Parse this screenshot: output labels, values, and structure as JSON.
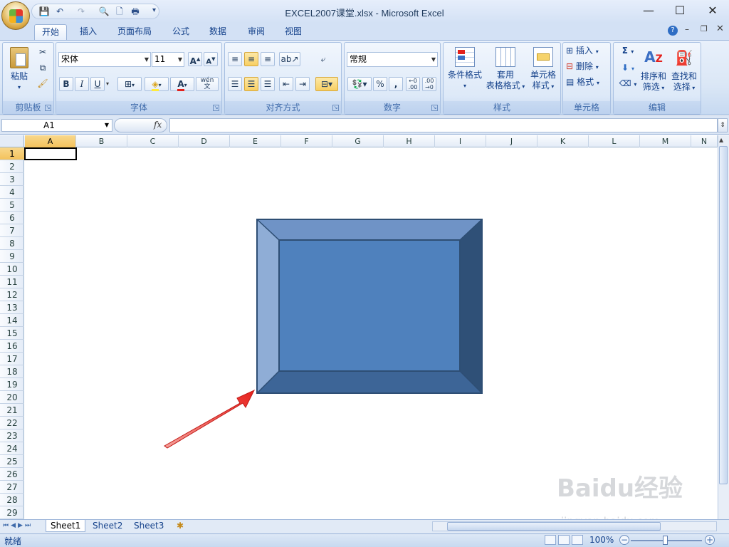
{
  "window": {
    "title": "EXCEL2007课堂.xlsx - Microsoft Excel",
    "minimize": "—",
    "maximize": "☐",
    "close": "✕"
  },
  "qat": {
    "items": [
      "save-icon",
      "undo-icon",
      "redo-icon",
      "print-preview-icon",
      "new-icon",
      "print-icon"
    ],
    "more": "▾"
  },
  "tabs": [
    "开始",
    "插入",
    "页面布局",
    "公式",
    "数据",
    "审阅",
    "视图"
  ],
  "active_tab": "开始",
  "ribbon": {
    "clipboard": {
      "label": "剪贴板",
      "paste": "粘贴"
    },
    "font": {
      "label": "字体",
      "font_name": "宋体",
      "font_size": "11",
      "bold": "B",
      "italic": "I",
      "underline": "U",
      "grow": "A",
      "shrink": "A",
      "phonetic": "wén"
    },
    "alignment": {
      "label": "对齐方式"
    },
    "number": {
      "label": "数字",
      "format": "常规",
      "percent": "%",
      "comma": ","
    },
    "styles": {
      "label": "样式",
      "conditional": "条件格式",
      "table_format_1": "套用",
      "table_format_2": "表格格式",
      "cell_style_1": "单元格",
      "cell_style_2": "样式"
    },
    "cells": {
      "label": "单元格",
      "insert": "插入",
      "delete": "删除",
      "format": "格式"
    },
    "editing": {
      "label": "编辑",
      "sum": "Σ",
      "sort_1": "排序和",
      "sort_2": "筛选",
      "find_1": "查找和",
      "find_2": "选择"
    }
  },
  "formula_bar": {
    "name_box": "A1",
    "fx": "fx",
    "value": ""
  },
  "columns": [
    "A",
    "B",
    "C",
    "D",
    "E",
    "F",
    "G",
    "H",
    "I",
    "J",
    "K",
    "L",
    "M",
    "N"
  ],
  "rows": [
    "1",
    "2",
    "3",
    "4",
    "5",
    "6",
    "7",
    "8",
    "9",
    "10",
    "11",
    "12",
    "13",
    "14",
    "15",
    "16",
    "17",
    "18",
    "19",
    "20",
    "21",
    "22",
    "23",
    "24",
    "25",
    "26",
    "27",
    "28",
    "29"
  ],
  "sheets": [
    "Sheet1",
    "Sheet2",
    "Sheet3"
  ],
  "active_sheet": "Sheet1",
  "status": {
    "ready": "就绪",
    "zoom": "100%"
  },
  "watermark": {
    "main": "Baidu经验",
    "sub": "jingyan.baidu.com"
  },
  "colors": {
    "shape_face": "#4f81bd",
    "shape_dark": "#2e4e74",
    "arrow": "#e8201c",
    "select_header": "#f4c25c"
  }
}
